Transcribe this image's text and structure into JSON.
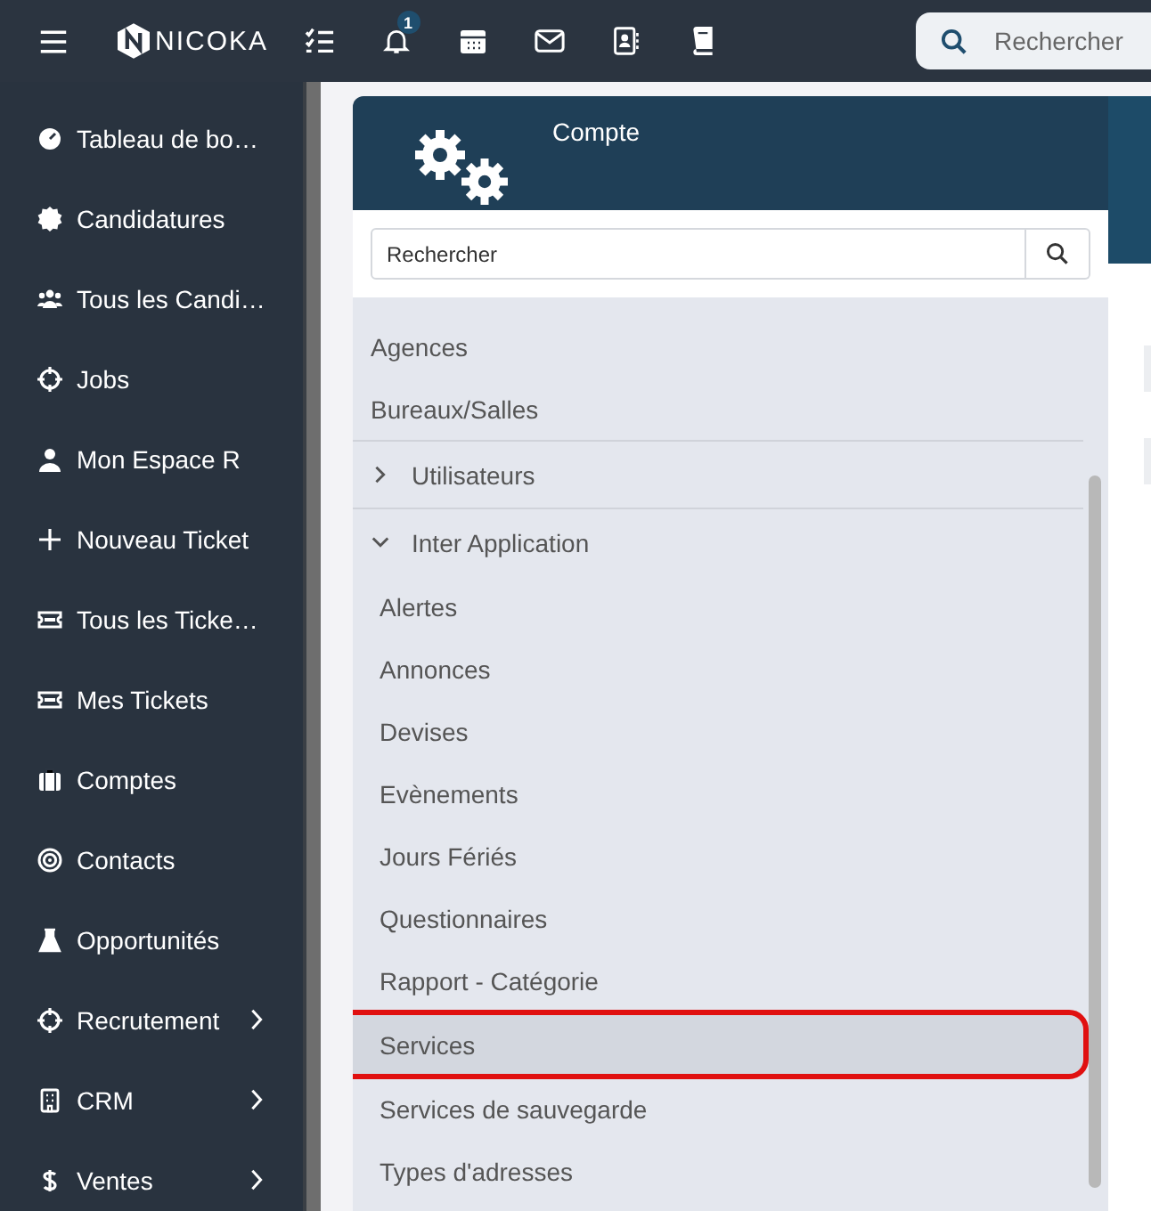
{
  "topbar": {
    "logo_text": "NICOKA",
    "notification_count": "1",
    "search": {
      "placeholder": "Rechercher"
    }
  },
  "sidebar": {
    "items": [
      {
        "label": "Tableau de bo…",
        "has_submenu": false
      },
      {
        "label": "Candidatures",
        "has_submenu": false
      },
      {
        "label": "Tous les Candi…",
        "has_submenu": false
      },
      {
        "label": "Jobs",
        "has_submenu": false
      },
      {
        "label": "Mon Espace R",
        "has_submenu": false
      },
      {
        "label": "Nouveau Ticket",
        "has_submenu": false
      },
      {
        "label": "Tous les Ticke…",
        "has_submenu": false
      },
      {
        "label": "Mes Tickets",
        "has_submenu": false
      },
      {
        "label": "Comptes",
        "has_submenu": false
      },
      {
        "label": "Contacts",
        "has_submenu": false
      },
      {
        "label": "Opportunités",
        "has_submenu": false
      },
      {
        "label": "Recrutement",
        "has_submenu": true
      },
      {
        "label": "CRM",
        "has_submenu": true
      },
      {
        "label": "Ventes",
        "has_submenu": true
      }
    ]
  },
  "panel": {
    "title": "Compte",
    "search": {
      "placeholder": "Rechercher"
    },
    "tree": [
      {
        "kind": "item",
        "label": "Agences",
        "selected": false
      },
      {
        "kind": "item",
        "label": "Bureaux/Salles",
        "selected": false
      },
      {
        "kind": "group",
        "label": "Utilisateurs",
        "expanded": false,
        "selected": false
      },
      {
        "kind": "group",
        "label": "Inter Application",
        "expanded": true,
        "selected": false,
        "children": [
          {
            "label": "Alertes",
            "selected": false
          },
          {
            "label": "Annonces",
            "selected": false
          },
          {
            "label": "Devises",
            "selected": false
          },
          {
            "label": "Evènements",
            "selected": false
          },
          {
            "label": "Jours Fériés",
            "selected": false
          },
          {
            "label": "Questionnaires",
            "selected": false
          },
          {
            "label": "Rapport - Catégorie",
            "selected": false
          },
          {
            "label": "Services",
            "selected": true
          },
          {
            "label": "Services de sauvegarde",
            "selected": false
          },
          {
            "label": "Types d'adresses",
            "selected": false
          }
        ]
      }
    ]
  }
}
